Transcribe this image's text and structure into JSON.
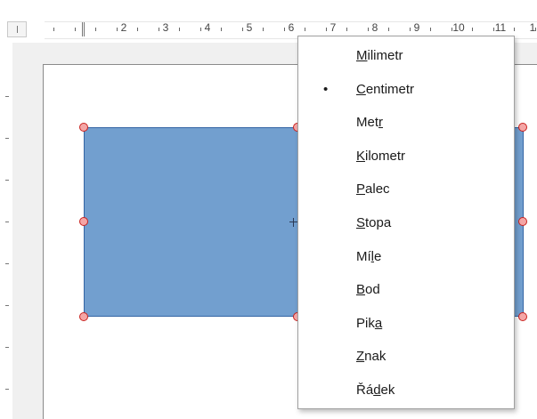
{
  "ruler": {
    "numbers": [
      "2",
      "3",
      "4",
      "5",
      "6",
      "7",
      "8",
      "9",
      "10",
      "11",
      "1"
    ],
    "left_box_label": ""
  },
  "shape": {
    "fill_color": "#729fcf",
    "border_color": "#3465a4",
    "handle_color": "#f4a6a6"
  },
  "context_menu": {
    "selected_index": 1,
    "bullet": "•",
    "items": [
      {
        "label": "Milimetr",
        "underline_index": 0
      },
      {
        "label": "Centimetr",
        "underline_index": 0
      },
      {
        "label": "Metr",
        "underline_index": 3
      },
      {
        "label": "Kilometr",
        "underline_index": 0
      },
      {
        "label": "Palec",
        "underline_index": 0
      },
      {
        "label": "Stopa",
        "underline_index": 0
      },
      {
        "label": "Míle",
        "underline_index": 2
      },
      {
        "label": "Bod",
        "underline_index": 0
      },
      {
        "label": "Pika",
        "underline_index": 3
      },
      {
        "label": "Znak",
        "underline_index": 0
      },
      {
        "label": "Řádek",
        "underline_index": 2
      }
    ]
  }
}
